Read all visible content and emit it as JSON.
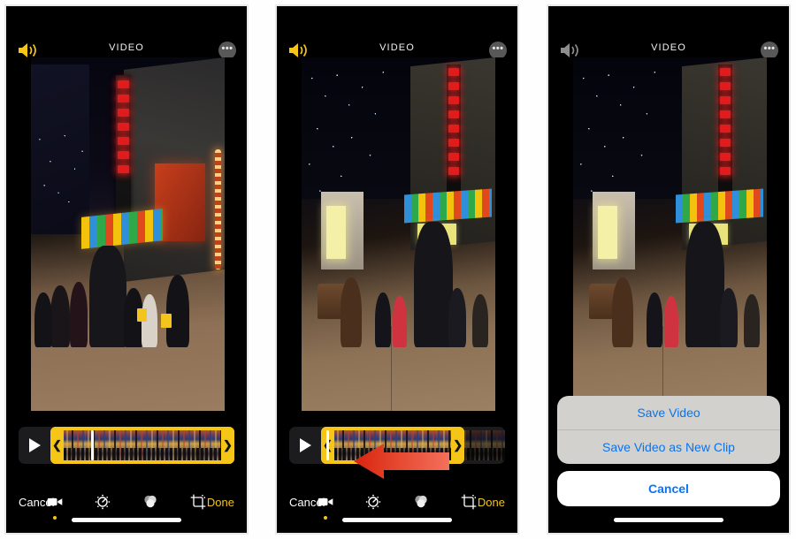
{
  "meta": {
    "screen_title": "VIDEO"
  },
  "colors": {
    "accent_yellow": "#f5c518",
    "sheet_blue": "#0a73f0",
    "sheet_grey": "#d2d1cd",
    "annotation_red": "#dd2a16",
    "phone_black": "#000000"
  },
  "phones": [
    {
      "id": "phone-1",
      "nav": {
        "title": "VIDEO",
        "speaker_icon": "speaker-on-icon",
        "more_icon": "more-options-icon"
      },
      "trim": {
        "play_icon": "play-icon",
        "left_handle_icon": "chevron-left-handle",
        "right_handle_icon": "chevron-right-handle",
        "selection_start_pct": 0,
        "selection_end_pct": 100,
        "playhead_pct": 22
      },
      "toolbar": {
        "cancel_label": "Cancel",
        "done_label": "Done",
        "icons": [
          {
            "name": "video-trim-icon",
            "active": true
          },
          {
            "name": "adjust-icon",
            "active": false
          },
          {
            "name": "filters-icon",
            "active": false
          },
          {
            "name": "crop-rotate-icon",
            "active": false
          }
        ]
      }
    },
    {
      "id": "phone-2",
      "nav": {
        "title": "VIDEO",
        "speaker_icon": "speaker-on-icon",
        "more_icon": "more-options-icon"
      },
      "trim": {
        "play_icon": "play-icon",
        "left_handle_icon": "chevron-left-handle",
        "right_handle_icon": "chevron-right-handle",
        "selection_start_pct": 0,
        "selection_end_pct": 78,
        "playhead_pct": 3
      },
      "toolbar": {
        "cancel_label": "Cancel",
        "done_label": "Done",
        "icons": [
          {
            "name": "video-trim-icon",
            "active": true
          },
          {
            "name": "adjust-icon",
            "active": false
          },
          {
            "name": "filters-icon",
            "active": false
          },
          {
            "name": "crop-rotate-icon",
            "active": false
          }
        ]
      },
      "annotation": {
        "type": "arrow-left",
        "color": "#dd2a16",
        "points_to": "right-trim-handle"
      }
    },
    {
      "id": "phone-3",
      "nav": {
        "title": "VIDEO",
        "speaker_icon": "speaker-on-icon",
        "more_icon": "more-options-icon"
      },
      "action_sheet": {
        "options": [
          "Save Video",
          "Save Video as New Clip"
        ],
        "cancel_label": "Cancel"
      }
    }
  ]
}
